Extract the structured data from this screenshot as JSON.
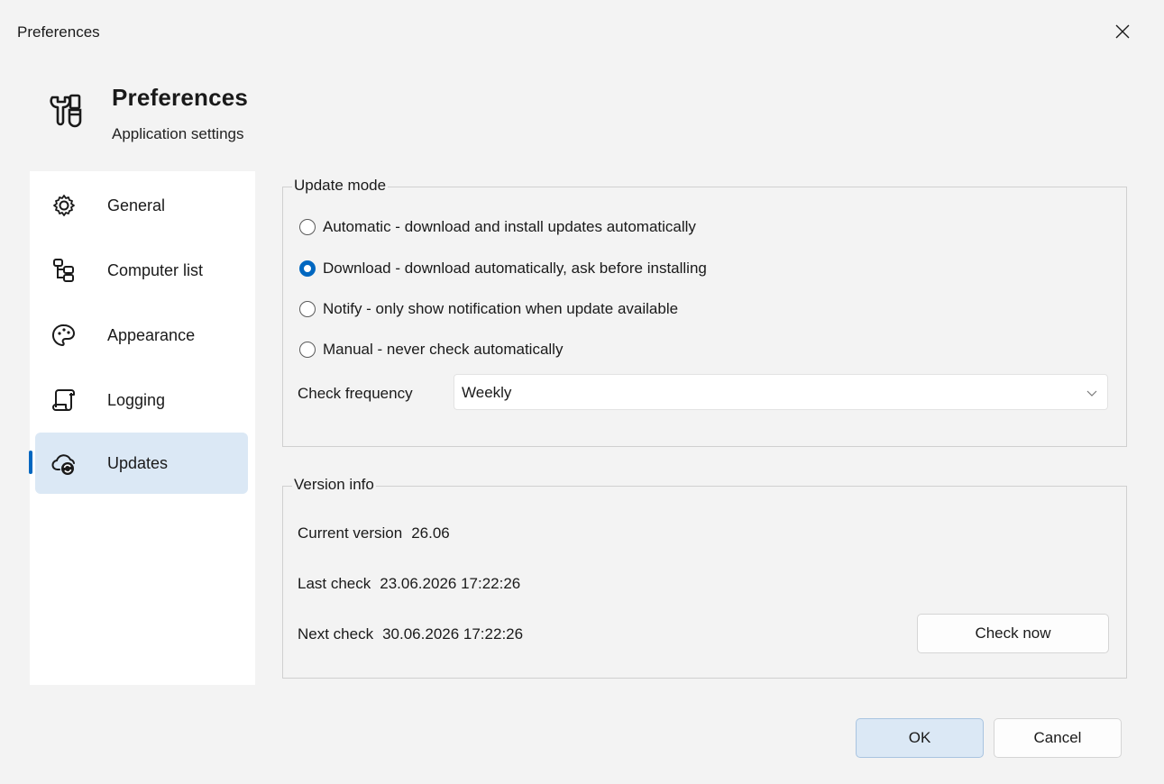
{
  "window": {
    "title": "Preferences",
    "close_icon": "close-icon"
  },
  "header": {
    "title": "Preferences",
    "subtitle": "Application settings",
    "icon": "tools-icon"
  },
  "sidebar": {
    "items": [
      {
        "label": "General",
        "icon": "gear-icon",
        "active": false
      },
      {
        "label": "Computer list",
        "icon": "tree-icon",
        "active": false
      },
      {
        "label": "Appearance",
        "icon": "palette-icon",
        "active": false
      },
      {
        "label": "Logging",
        "icon": "scroll-icon",
        "active": false
      },
      {
        "label": "Updates",
        "icon": "cloud-sync-icon",
        "active": true
      }
    ]
  },
  "update_mode": {
    "legend": "Update mode",
    "options": [
      {
        "label": "Automatic - download and install updates automatically",
        "checked": false
      },
      {
        "label": "Download - download automatically, ask before installing",
        "checked": true
      },
      {
        "label": "Notify - only show notification when update available",
        "checked": false
      },
      {
        "label": "Manual - never check automatically",
        "checked": false
      }
    ],
    "frequency_label": "Check frequency",
    "frequency_value": "Weekly"
  },
  "version_info": {
    "legend": "Version info",
    "current_version_label": "Current version",
    "current_version_value": "26.06",
    "last_check_label": "Last check",
    "last_check_value": "23.06.2026 17:22:26",
    "next_check_label": "Next check",
    "next_check_value": "30.06.2026 17:22:26",
    "check_now_label": "Check now"
  },
  "footer": {
    "ok_label": "OK",
    "cancel_label": "Cancel"
  },
  "colors": {
    "accent": "#0067c0",
    "selected_bg": "#dbe8f5",
    "window_bg": "#f3f3f3"
  }
}
